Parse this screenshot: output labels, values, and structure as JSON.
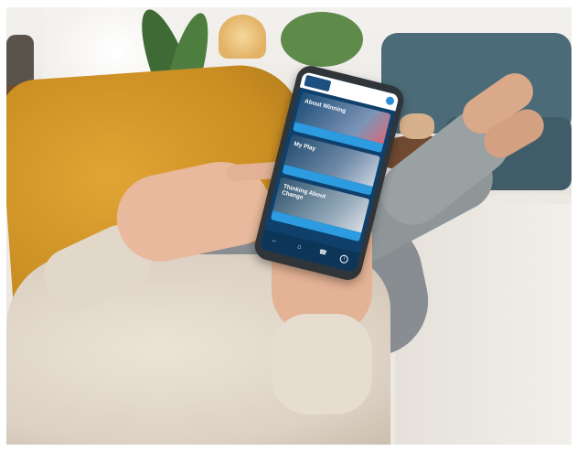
{
  "phone": {
    "logo_label": "",
    "cards": [
      {
        "title": "About Winning",
        "button_label": ""
      },
      {
        "title": "My Play",
        "button_label": ""
      },
      {
        "title": "Thinking About Change",
        "button_label": ""
      }
    ],
    "nav_icons": [
      "back-icon",
      "home-icon",
      "phone-icon",
      "info-icon"
    ]
  },
  "colors": {
    "app_primary": "#0f3f6b",
    "app_accent": "#2c9be0",
    "pillow": "#d39a2b",
    "sweater": "#e3d9cc"
  }
}
